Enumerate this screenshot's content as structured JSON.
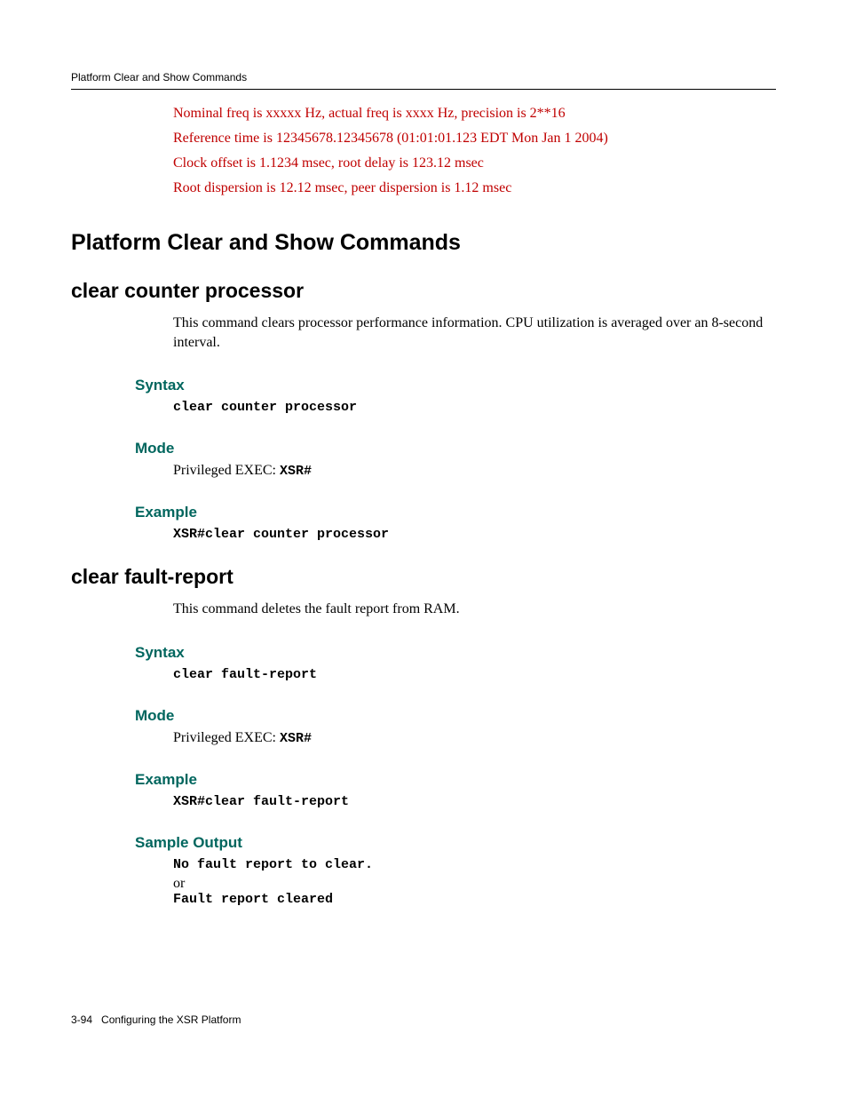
{
  "header": "Platform Clear and Show Commands",
  "red_lines": [
    "Nominal freq is xxxxx Hz, actual freq is xxxx Hz, precision is 2**16",
    "Reference time is 12345678.12345678 (01:01:01.123 EDT Mon Jan 1 2004)",
    "Clock offset is 1.1234 msec, root delay is 123.12 msec",
    "Root dispersion is 12.12 msec, peer dispersion is 1.12 msec"
  ],
  "h1": "Platform Clear and Show Commands",
  "section1": {
    "title": "clear counter processor",
    "desc": "This command clears processor performance information. CPU utilization is averaged over an 8-second interval.",
    "syntax_label": "Syntax",
    "syntax_code": "clear counter processor",
    "mode_label": "Mode",
    "mode_prefix": "Privileged EXEC: ",
    "mode_code": "XSR#",
    "example_label": "Example",
    "example_code": "XSR#clear counter processor"
  },
  "section2": {
    "title": "clear fault-report",
    "desc": "This command deletes the fault report from RAM.",
    "syntax_label": "Syntax",
    "syntax_code": "clear fault-report",
    "mode_label": "Mode",
    "mode_prefix": "Privileged EXEC: ",
    "mode_code": "XSR#",
    "example_label": "Example",
    "example_code": "XSR#clear fault-report",
    "sample_label": "Sample Output",
    "sample_line1": "No fault report to clear.",
    "sample_or": "or",
    "sample_line2": "Fault report cleared"
  },
  "footer": {
    "page_num": "3-94",
    "chapter": "Configuring the XSR Platform"
  }
}
